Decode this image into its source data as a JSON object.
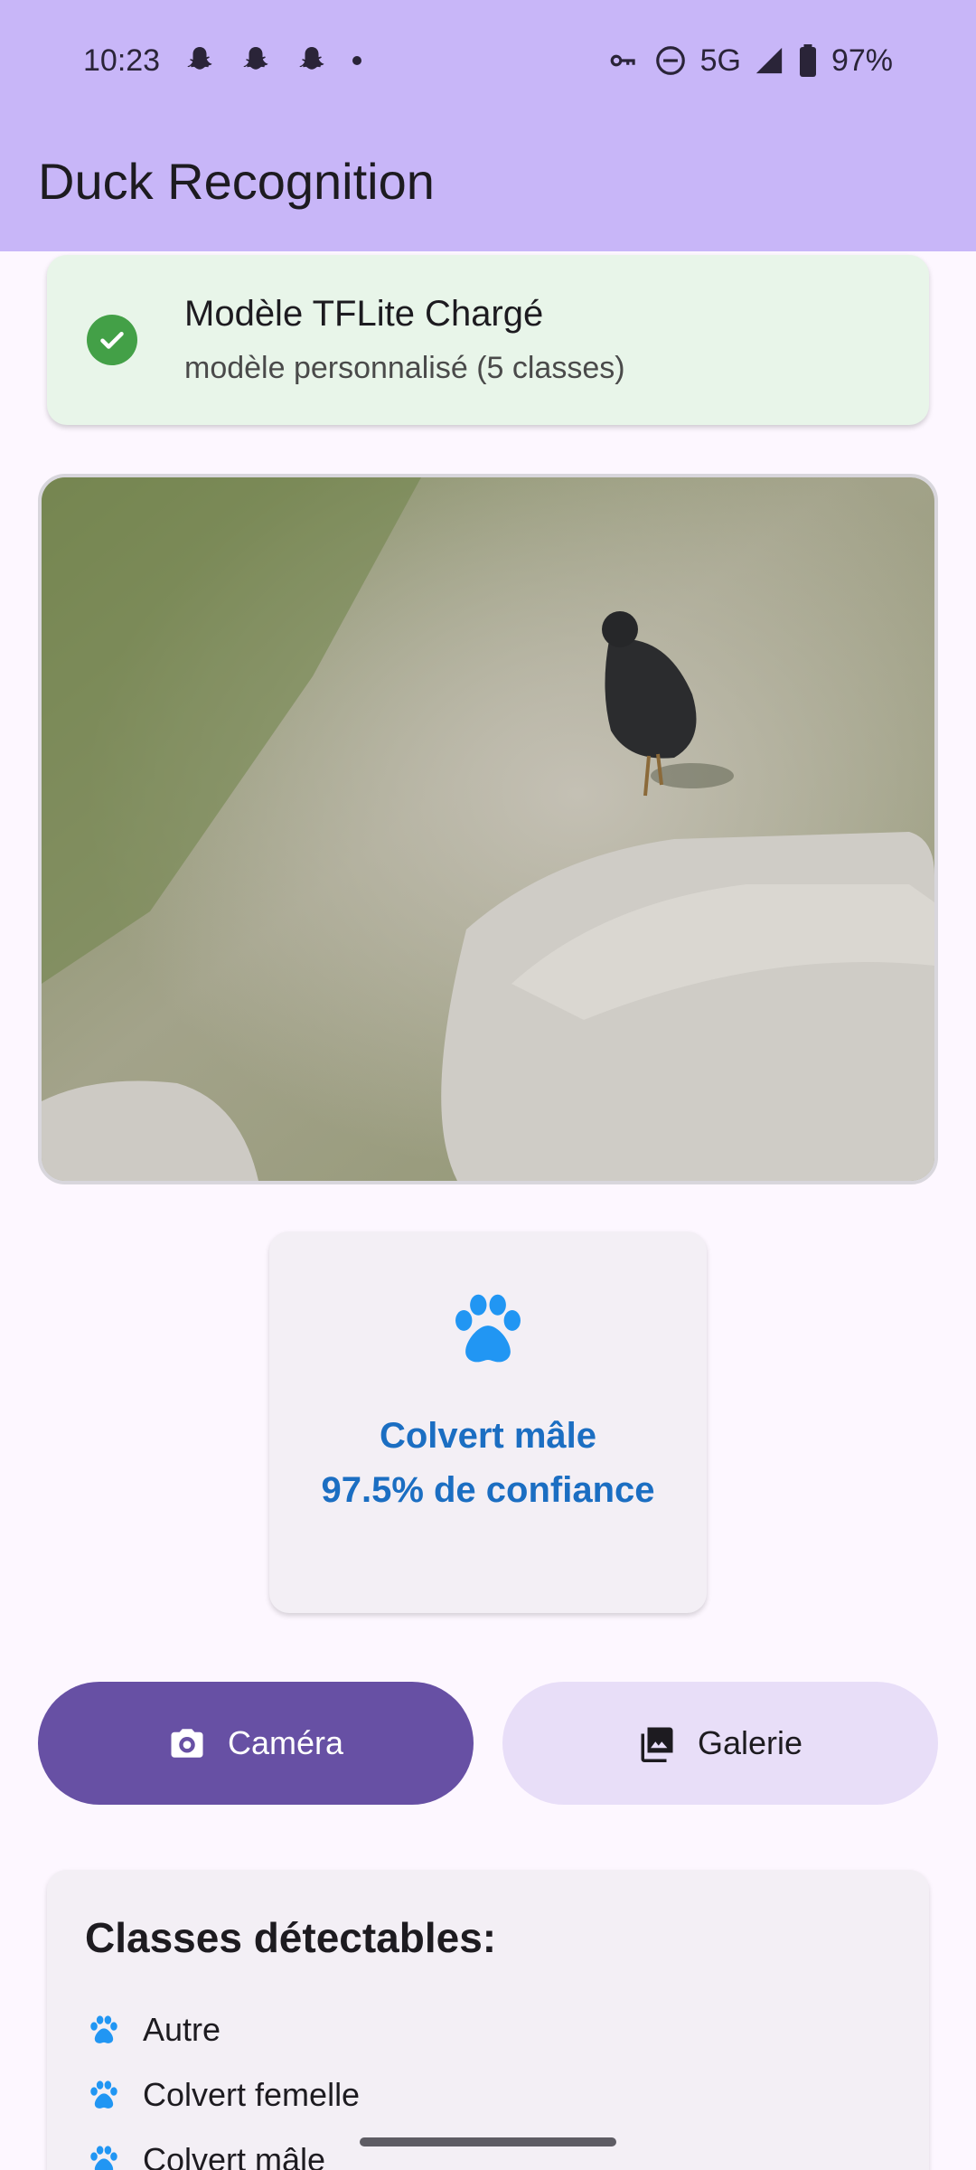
{
  "status_bar": {
    "time": "10:23",
    "network": "5G",
    "battery": "97%",
    "icons": [
      "snapchat-icon",
      "snapchat-icon",
      "snapchat-icon",
      "dot-icon",
      "vpn-key-icon",
      "do-not-disturb-icon",
      "signal-icon",
      "battery-icon"
    ]
  },
  "app_bar": {
    "title": "Duck Recognition"
  },
  "model_status": {
    "title": "Modèle TFLite Chargé",
    "subtitle": "modèle personnalisé (5 classes)",
    "icon": "check-circle-icon",
    "color": "#43a047"
  },
  "result": {
    "icon": "paw-icon",
    "label": "Colvert mâle",
    "confidence_text": "97.5% de confiance",
    "color": "#1b6ec2"
  },
  "buttons": {
    "camera": {
      "label": "Caméra",
      "icon": "camera-icon",
      "color": "#6750a4"
    },
    "gallery": {
      "label": "Galerie",
      "icon": "image-icon",
      "color": "#e8def8"
    }
  },
  "classes": {
    "title": "Classes détectables:",
    "items": [
      "Autre",
      "Colvert femelle",
      "Colvert mâle"
    ]
  },
  "colors": {
    "app_bar": "#c8b6f8",
    "accent": "#2196f3"
  }
}
